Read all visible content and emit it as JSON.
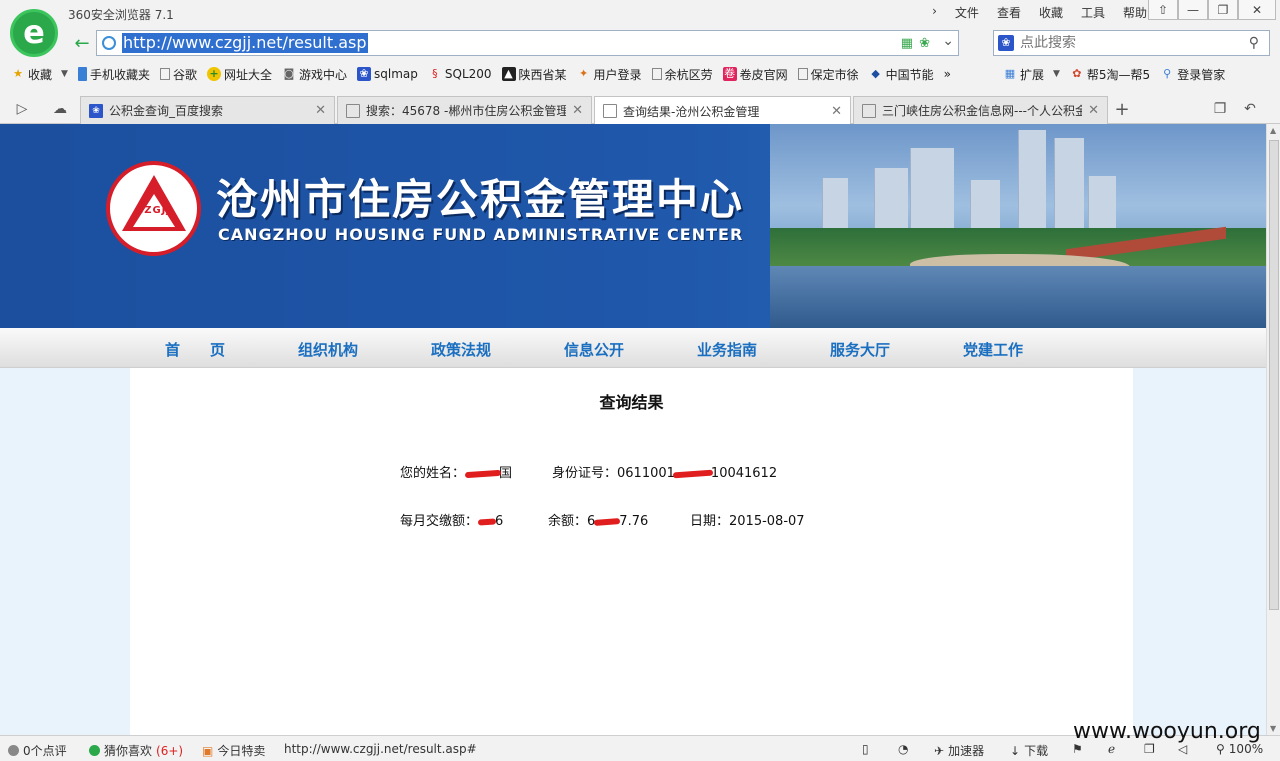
{
  "browser": {
    "app_title": "360安全浏览器 7.1",
    "menu": [
      "文件",
      "查看",
      "收藏",
      "工具",
      "帮助"
    ],
    "window_controls": [
      "⇧",
      "—",
      "❐",
      "✕"
    ],
    "address": "http://www.czgjj.net/result.asp",
    "search_placeholder": "点此搜索",
    "bookmarks": [
      {
        "label": "收藏",
        "icon": "star-icon"
      },
      {
        "label": "手机收藏夹",
        "icon": "phone-icon"
      },
      {
        "label": "谷歌",
        "icon": "page-icon"
      },
      {
        "label": "网址大全",
        "icon": "nav-icon"
      },
      {
        "label": "游戏中心",
        "icon": "gamepad-icon"
      },
      {
        "label": "sqlmap",
        "icon": "paw-icon"
      },
      {
        "label": "SQL200",
        "icon": "sql-icon"
      },
      {
        "label": "陕西省某",
        "icon": "shaanxi-icon"
      },
      {
        "label": "用户登录",
        "icon": "user-icon"
      },
      {
        "label": "余杭区劳",
        "icon": "page-icon"
      },
      {
        "label": "卷皮官网",
        "icon": "juanpi-icon"
      },
      {
        "label": "保定市徐",
        "icon": "page-icon"
      },
      {
        "label": "中国节能",
        "icon": "cecep-icon"
      }
    ],
    "bookmarks_more": "»",
    "extensions": [
      {
        "label": "扩展",
        "icon": "grid-icon"
      },
      {
        "label": "帮5淘—帮5",
        "icon": "bang5-icon"
      },
      {
        "label": "登录管家",
        "icon": "login-icon"
      }
    ],
    "tabs": [
      {
        "title": "公积金查询_百度搜索",
        "icon": "paw-icon",
        "active": false
      },
      {
        "title": "搜索：45678 -郴州市住房公积金管理",
        "icon": "page-icon",
        "active": false
      },
      {
        "title": "查询结果-沧州公积金管理",
        "icon": "page-icon",
        "active": true
      },
      {
        "title": "三门峡住房公积金信息网---个人公积金",
        "icon": "page-icon",
        "active": false
      }
    ],
    "new_tab": "+",
    "status": {
      "reviews": "0个点评",
      "guess": "猜你喜欢",
      "guess_count": "(6+)",
      "daily_deal": "今日特卖",
      "hover_url": "http://www.czgjj.net/result.asp#",
      "accelerator": "加速器",
      "download": "下载",
      "zoom": "100%"
    }
  },
  "site": {
    "title_cn": "沧州市住房公积金管理中心",
    "title_en": "CANGZHOU HOUSING FUND ADMINISTRATIVE CENTER",
    "emblem_text": "CZGJJ",
    "nav": [
      "首　　页",
      "组织机构",
      "政策法规",
      "信息公开",
      "业务指南",
      "服务大厅",
      "党建工作"
    ]
  },
  "result": {
    "heading": "查询结果",
    "name_label": "您的姓名：",
    "name_visible": "国",
    "id_label": "身份证号：",
    "id_prefix": "0611001",
    "id_suffix": "10041612",
    "monthly_label": "每月交缴额：",
    "monthly_visible": "6",
    "balance_label": "余额：",
    "balance_prefix": "6",
    "balance_suffix": "7.76",
    "date_label": "日期：",
    "date_value": "2015-08-07"
  },
  "watermark": "www.wooyun.org"
}
